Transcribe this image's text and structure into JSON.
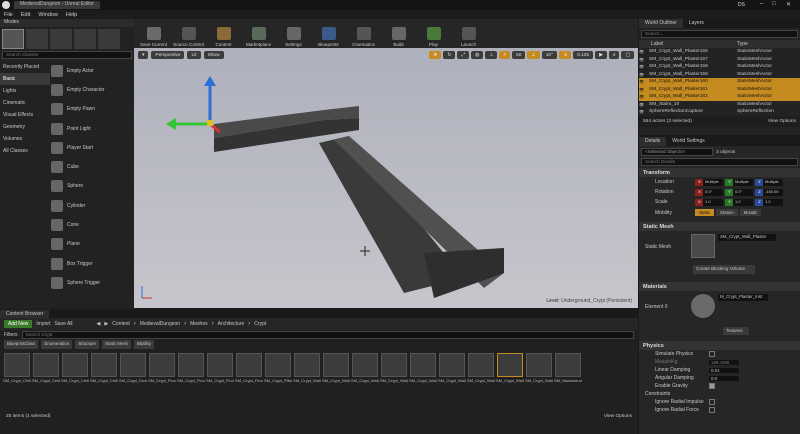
{
  "window": {
    "tab": "MedievalDungeon - Unreal Editor",
    "user": "DS",
    "menus": [
      "File",
      "Edit",
      "Window",
      "Help"
    ]
  },
  "modes": {
    "tab": "Modes",
    "search_placeholder": "Search Classes",
    "categories": [
      "Recently Placed",
      "Basic",
      "Lights",
      "Cinematic",
      "Visual Effects",
      "Geometry",
      "Volumes",
      "All Classes"
    ],
    "items": [
      "Empty Actor",
      "Empty Character",
      "Empty Pawn",
      "Point Light",
      "Player Start",
      "Cube",
      "Sphere",
      "Cylinder",
      "Cone",
      "Plane",
      "Box Trigger",
      "Sphere Trigger"
    ]
  },
  "toolbar": {
    "buttons": [
      "Save Current",
      "Source Control",
      "Content",
      "Marketplace",
      "Settings",
      "Blueprints",
      "Cinematics",
      "Build",
      "Play",
      "Launch"
    ]
  },
  "viewport": {
    "perspective": "Perspective",
    "lit": "Lit",
    "show": "Show",
    "snap_angle": "10°",
    "snap_scale": "0.125",
    "camera_speed": "4",
    "level": "Level:",
    "level_name": "Underground_Crypt (Persistent)"
  },
  "outliner": {
    "tabs": [
      "World Outliner",
      "Layers"
    ],
    "search_placeholder": "Search...",
    "col_label": "Label",
    "col_type": "Type",
    "rows": [
      {
        "label": "SM_Crypt_Wall_Plaster156",
        "type": "StaticMeshActor",
        "sel": false
      },
      {
        "label": "SM_Crypt_Wall_Plaster157",
        "type": "StaticMeshActor",
        "sel": false
      },
      {
        "label": "SM_Crypt_Wall_Plaster158",
        "type": "StaticMeshActor",
        "sel": false
      },
      {
        "label": "SM_Crypt_Wall_Plaster159",
        "type": "StaticMeshActor",
        "sel": false
      },
      {
        "label": "SM_Crypt_Wall_Plaster160",
        "type": "StaticMeshActor",
        "sel": true
      },
      {
        "label": "SM_Crypt_Wall_Plaster161",
        "type": "StaticMeshActor",
        "sel": true
      },
      {
        "label": "SM_Crypt_Wall_Plaster162",
        "type": "StaticMeshActor",
        "sel": true
      },
      {
        "label": "SM_Stairs_10",
        "type": "StaticMeshActor",
        "sel": false
      },
      {
        "label": "SphereReflectionCapture",
        "type": "SphereReflection",
        "sel": false
      }
    ],
    "footer": "554 actors (3 selected)",
    "view_options": "View Options"
  },
  "details": {
    "tabs": [
      "Details",
      "World Settings"
    ],
    "search_placeholder": "<Selected Objects>",
    "objects": "3 objects",
    "search_details": "Search Details",
    "transform": "Transform",
    "location": "Location",
    "rotation": "Rotation",
    "scale": "Scale",
    "mobility": "Mobility",
    "loc": [
      "Multiple",
      "Multiple",
      "Multiple"
    ],
    "rot": [
      "0.0°",
      "0.0°",
      "-180.00"
    ],
    "scl": [
      "1.0",
      "1.0",
      "1.0"
    ],
    "mob": [
      "Static",
      "Station",
      "Movab"
    ],
    "static_mesh_sec": "Static Mesh",
    "static_mesh": "Static Mesh",
    "mesh_name": "SM_Crypt_Wall_Plaster",
    "blocking": "Create Blocking Volume",
    "materials": "Materials",
    "element0": "Element 0",
    "mat_name": "M_Crypt_Plaster_Inst",
    "textures": "Textures",
    "physics": "Physics",
    "sim": "Simulate Physics",
    "mass": "MassInKg",
    "mass_val": "189.4298",
    "lin_damp": "Linear Damping",
    "lin_val": "0.01",
    "ang_damp": "Angular Damping",
    "ang_val": "0.0",
    "grav": "Enable Gravity",
    "constraints": "Constraints",
    "irf": "Ignore Radial Impulse",
    "irf2": "Ignore Radial Force"
  },
  "content": {
    "tab": "Content Browser",
    "add_new": "Add New",
    "import": "Import",
    "save_all": "Save All",
    "path": [
      "Content",
      "MedievalDungeon",
      "Meshes",
      "Architecture",
      "Crypt"
    ],
    "filters": "Filters",
    "search_placeholder": "Search Crypt",
    "filter_chips": [
      "BlueprintClass",
      "Enumeration",
      "Structure",
      "Static Mesh",
      "Blutility"
    ],
    "assets": [
      "SM_Crypt_Ceiling",
      "SM_Crypt_Ceiling_Arch",
      "SM_Crypt_Ceiling_Half",
      "SM_Crypt_Ceiling_Half_B",
      "SM_Crypt_Doorway",
      "SM_Crypt_Floor",
      "SM_Crypt_Floor_Corner",
      "SM_Crypt_Floor_Corner_End_A",
      "SM_Crypt_Floor_Corner_End_B",
      "SM_Crypt_Pillar",
      "SM_Crypt_Wall",
      "SM_Crypt_Wall_Decorative_A",
      "SM_Crypt_Wall_Decorative_B",
      "SM_Crypt_Wall_Decorative_C",
      "SM_Crypt_Wall_Decorative_D",
      "SM_Crypt_Wall_Floor_Trim",
      "SM_Crypt_Wall_Half",
      "SM_Crypt_Wall_Plaster",
      "SM_Crypt_Stair_Side",
      "SM_Mausoleum"
    ],
    "footer": "25 items (1 selected)",
    "view_options": "View Options"
  }
}
